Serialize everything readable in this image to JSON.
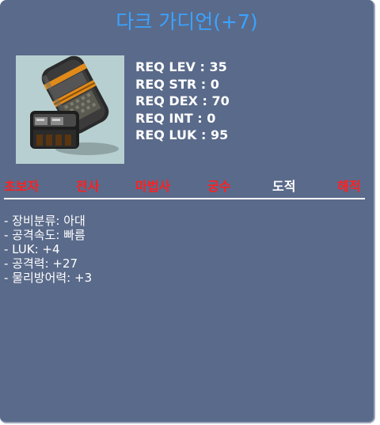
{
  "item": {
    "name": "다크 가디언(+7)",
    "icon": "dark-guardian-gauntlet",
    "requirements": [
      {
        "label": "REQ LEV",
        "value": "35"
      },
      {
        "label": "REQ STR",
        "value": "0"
      },
      {
        "label": "REQ DEX",
        "value": "70"
      },
      {
        "label": "REQ INT",
        "value": "0"
      },
      {
        "label": "REQ LUK",
        "value": "95"
      }
    ],
    "jobs": [
      {
        "label": "초보자",
        "color": "#ff2020"
      },
      {
        "label": "전사",
        "color": "#ff2020"
      },
      {
        "label": "마법사",
        "color": "#ff2020"
      },
      {
        "label": "궁수",
        "color": "#ff2020"
      },
      {
        "label": "도적",
        "color": "#ffffff"
      },
      {
        "label": "해적",
        "color": "#ff2020"
      }
    ],
    "description": [
      "- 장비분류: 아대",
      "- 공격속도: 빠름",
      "- LUK: +4",
      "- 공격력: +27",
      "- 물리방어력: +3"
    ]
  },
  "colors": {
    "title": "#3aa3ff",
    "background": "#5a6a8a",
    "unavailable_job": "#ff2020",
    "available_job": "#ffffff"
  }
}
